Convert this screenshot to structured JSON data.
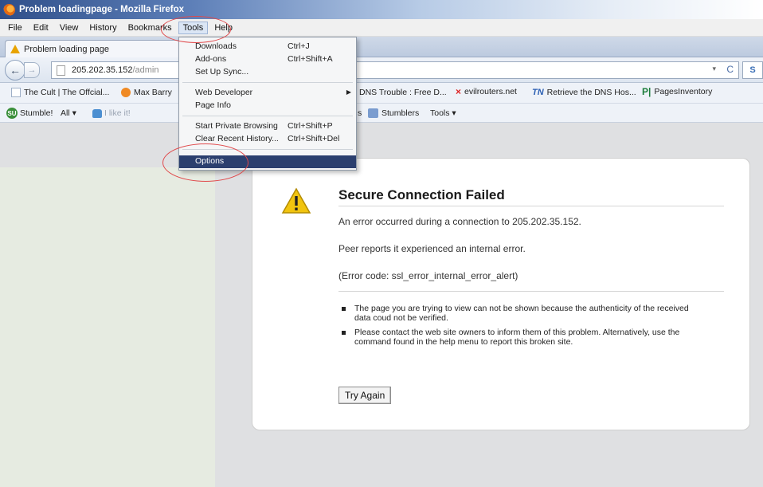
{
  "window": {
    "title": "Problem loadingpage - Mozilla Firefox"
  },
  "menubar": {
    "items": [
      "File",
      "Edit",
      "View",
      "History",
      "Bookmarks",
      "Tools",
      "Help"
    ],
    "active": "Tools"
  },
  "tab": {
    "label": "Problem loading page"
  },
  "urlbar": {
    "host": "205.202.35.152",
    "path": "/admin",
    "reload_icon": "C",
    "search_icon": "S"
  },
  "bookmarks": {
    "items": [
      "The Cult | The Offcial...",
      "Max Barry",
      "DNS Trouble : Free D...",
      "evilrouters.net",
      "Retrieve the DNS Hos...",
      "PagesInventory"
    ],
    "icon_texts": {
      "tn": "TN",
      "pi": "P|",
      "x": "×"
    }
  },
  "stumblebar": {
    "stumble": "Stumble!",
    "all": "All ▾",
    "like": "I like it!",
    "stumblers": "Stumblers",
    "tools": "Tools ▾",
    "su_logo": "SU",
    "small_s": "s"
  },
  "tools_menu": {
    "items": [
      {
        "label": "Downloads",
        "shortcut": "Ctrl+J"
      },
      {
        "label": "Add-ons",
        "shortcut": "Ctrl+Shift+A"
      },
      {
        "label": "Set Up Sync...",
        "shortcut": ""
      },
      {
        "label": "Web Developer",
        "shortcut": ""
      },
      {
        "label": "Page Info",
        "shortcut": ""
      },
      {
        "label": "Start Private Browsing",
        "shortcut": "Ctrl+Shift+P"
      },
      {
        "label": "Clear Recent History...",
        "shortcut": "Ctrl+Shift+Del"
      },
      {
        "label": "Options",
        "shortcut": ""
      }
    ],
    "selected": "Options",
    "submenu_arrow": "▶"
  },
  "error": {
    "title": "Secure Connection Failed",
    "line1": "An error occurred during a connection to 205.202.35.152.",
    "line2": "Peer reports it experienced an internal error.",
    "line3": "(Error code: ssl_error_internal_error_alert)",
    "bullet1": "The page you are trying to view can not be shown because the authenticity of the received data coud not be verified.",
    "bullet2": "Please contact the web site owners to inform them of this problem. Alternatively, use the command found in the help menu to report this broken site.",
    "button": "Try Again"
  },
  "colors": {
    "selected_menu": "#2b3f6e",
    "annotation": "#e0484a",
    "warning": "#f1c40f"
  },
  "icons": [
    "firefox-logo-icon",
    "warning-icon",
    "back-arrow-icon",
    "forward-arrow-icon",
    "reload-icon",
    "page-icon",
    "stumbleupon-icon",
    "thumbs-up-icon"
  ]
}
